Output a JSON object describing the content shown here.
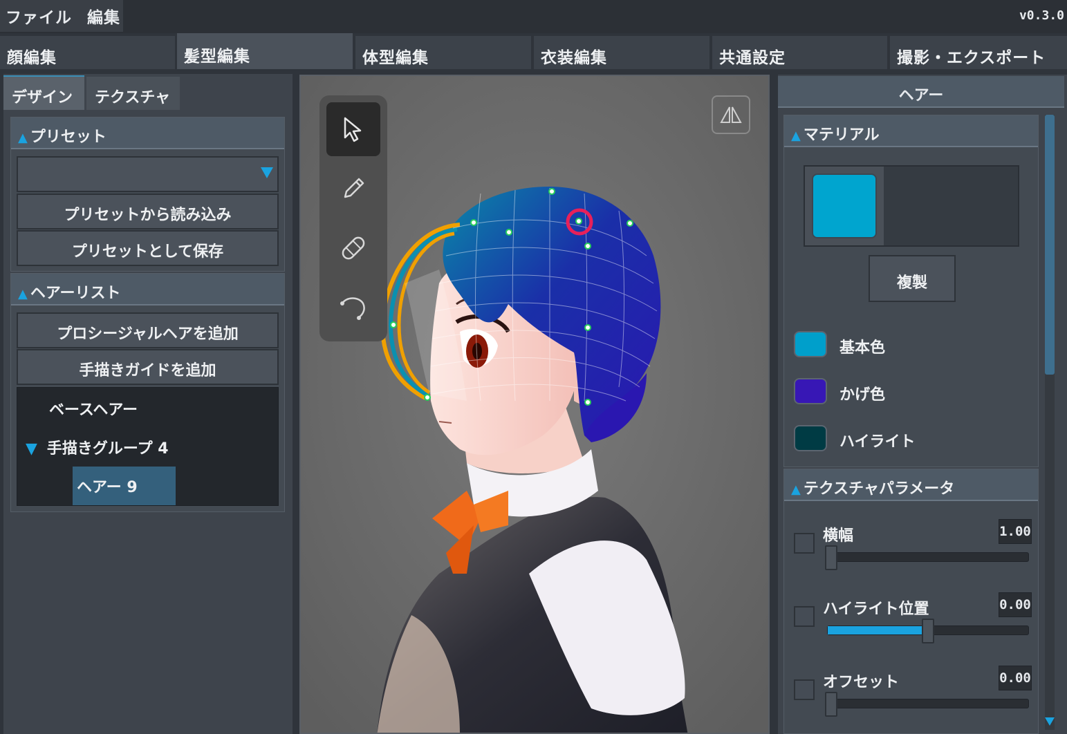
{
  "menubar": {
    "items": [
      "ファイル",
      "編集"
    ],
    "version": "v0.3.0"
  },
  "main_tabs": [
    "顔編集",
    "髪型編集",
    "体型編集",
    "衣装編集",
    "共通設定",
    "撮影・エクスポート"
  ],
  "main_tabs_active": "髪型編集",
  "left": {
    "subtabs": [
      "デザイン",
      "テクスチャ"
    ],
    "subtab_active": "デザイン",
    "preset": {
      "title": "プリセット",
      "dropdown_value": "",
      "load_button": "プリセットから読み込み",
      "save_button": "プリセットとして保存"
    },
    "hair_list": {
      "title": "ヘアーリスト",
      "add_procedural_button": "プロシージャルヘアを追加",
      "add_guide_button": "手描きガイドを追加",
      "items": {
        "base": "ベースヘアー",
        "group": "手描きグループ 4",
        "hair": "ヘアー 9"
      }
    }
  },
  "viewport": {
    "tools": [
      "select-tool",
      "pen-tool",
      "eraser-tool",
      "curve-tool"
    ],
    "active_tool": "select-tool"
  },
  "right": {
    "title": "ヘアー",
    "material": {
      "title": "マテリアル",
      "preview_color": "#00a5cf",
      "duplicate_button": "複製",
      "colors": [
        {
          "label": "基本色",
          "value": "#009fcb"
        },
        {
          "label": "かげ色",
          "value": "#3717b5"
        },
        {
          "label": "ハイライト",
          "value": "#003b44"
        }
      ]
    },
    "texture_params": {
      "title": "テクスチャパラメータ",
      "params": [
        {
          "label": "横幅",
          "value": "1.00",
          "level": 0.0
        },
        {
          "label": "ハイライト位置",
          "value": "0.00",
          "level": 0.5
        },
        {
          "label": "オフセット",
          "value": "0.00",
          "level": 0.0
        }
      ]
    }
  },
  "colors": {
    "accent": "#1aa3e0",
    "selected_item": "#34607c"
  }
}
